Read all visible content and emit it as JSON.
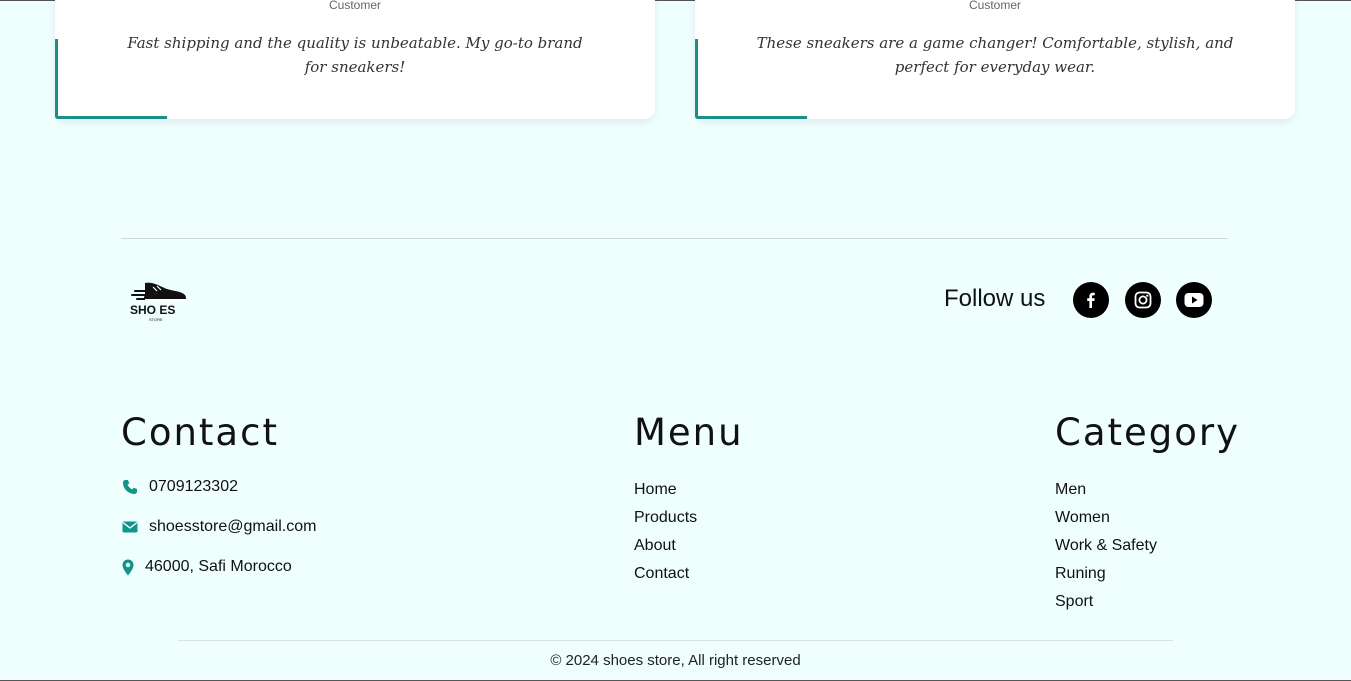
{
  "testimonials": [
    {
      "role": "Customer",
      "quote": "Fast shipping and the quality is unbeatable. My go-to brand for sneakers!"
    },
    {
      "role": "Customer",
      "quote": "These sneakers are a game changer! Comfortable, stylish, and perfect for everyday wear."
    }
  ],
  "footer": {
    "logo": {
      "brand_text": "SHO ES",
      "sub_text": "STORE",
      "icon": "sneaker-logo-icon"
    },
    "follow_label": "Follow us",
    "social": [
      {
        "name": "facebook",
        "icon": "facebook-icon"
      },
      {
        "name": "instagram",
        "icon": "instagram-icon"
      },
      {
        "name": "youtube",
        "icon": "youtube-icon"
      }
    ],
    "contact": {
      "title": "Contact",
      "phone": "0709123302",
      "email": "shoesstore@gmail.com",
      "address": "46000, Safi Morocco"
    },
    "menu": {
      "title": "Menu",
      "items": [
        "Home",
        "Products",
        "About",
        "Contact"
      ]
    },
    "category": {
      "title": "Category",
      "items": [
        "Men",
        "Women",
        "Work & Safety",
        "Runing",
        "Sport"
      ]
    },
    "copyright": "© 2024 shoes store, All right reserved"
  },
  "colors": {
    "background": "#effffe",
    "accent": "#1a8f86",
    "icon_accent": "#139488",
    "social_bg": "#000000"
  }
}
